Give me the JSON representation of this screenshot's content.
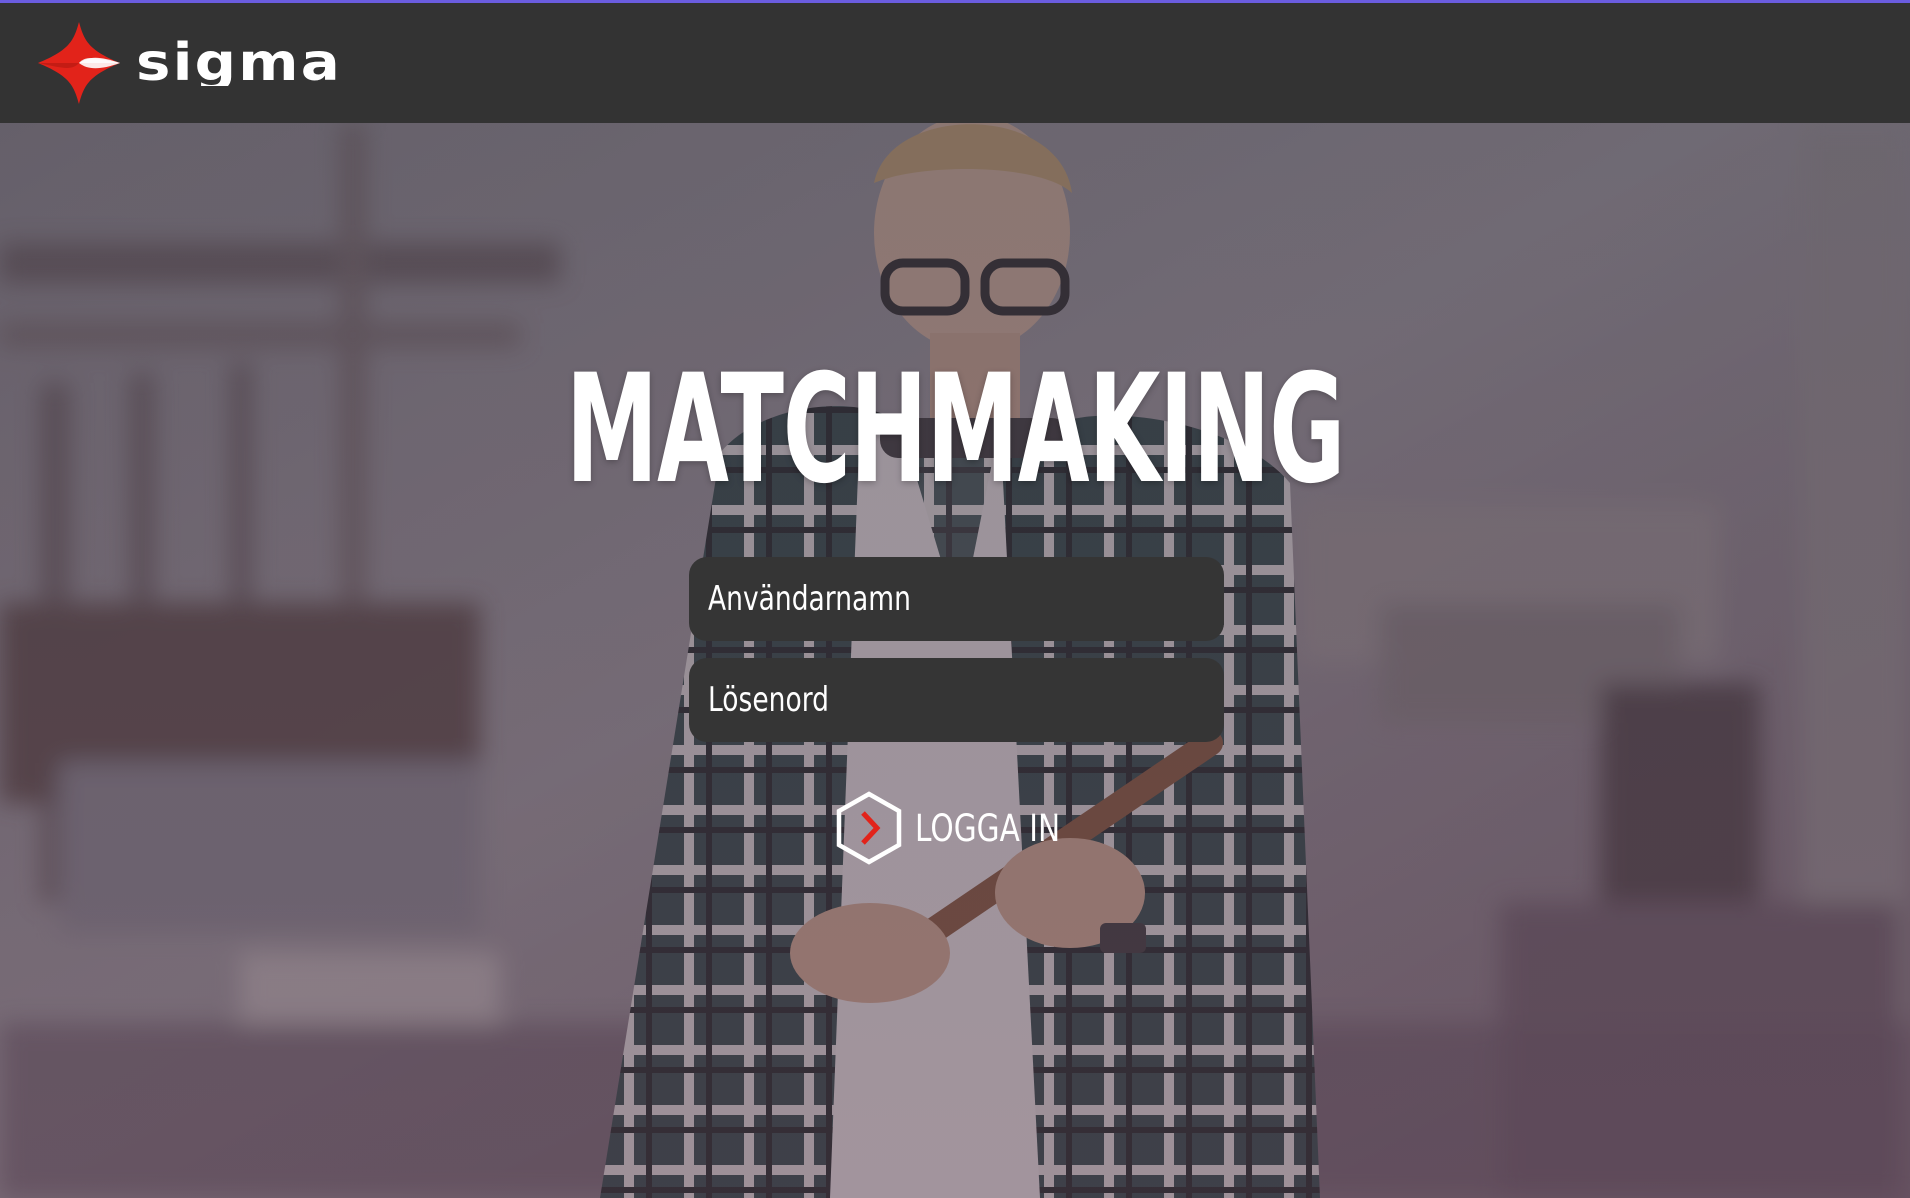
{
  "header": {
    "brand_name": "SIGMA",
    "logo_icon": "sigma-cross-logo-icon",
    "brand_colors": {
      "logo_red": "#e2231a",
      "logo_white": "#ffffff",
      "bar": "#333333",
      "accent_line": "#6b5de0"
    }
  },
  "hero": {
    "title": "MATCHMAKING",
    "background": "blurred-workshop-photo-with-young-man-in-plaid-shirt-holding-pipe"
  },
  "login_form": {
    "username": {
      "value": "",
      "placeholder": "Användarnamn"
    },
    "password": {
      "value": "",
      "placeholder": "Lösenord"
    },
    "submit": {
      "label": "LOGGA IN",
      "icon": "hexagon-chevron-right-icon"
    }
  },
  "colors": {
    "field_bg": "#353535",
    "text": "#ffffff",
    "chevron_red": "#e2231a"
  }
}
